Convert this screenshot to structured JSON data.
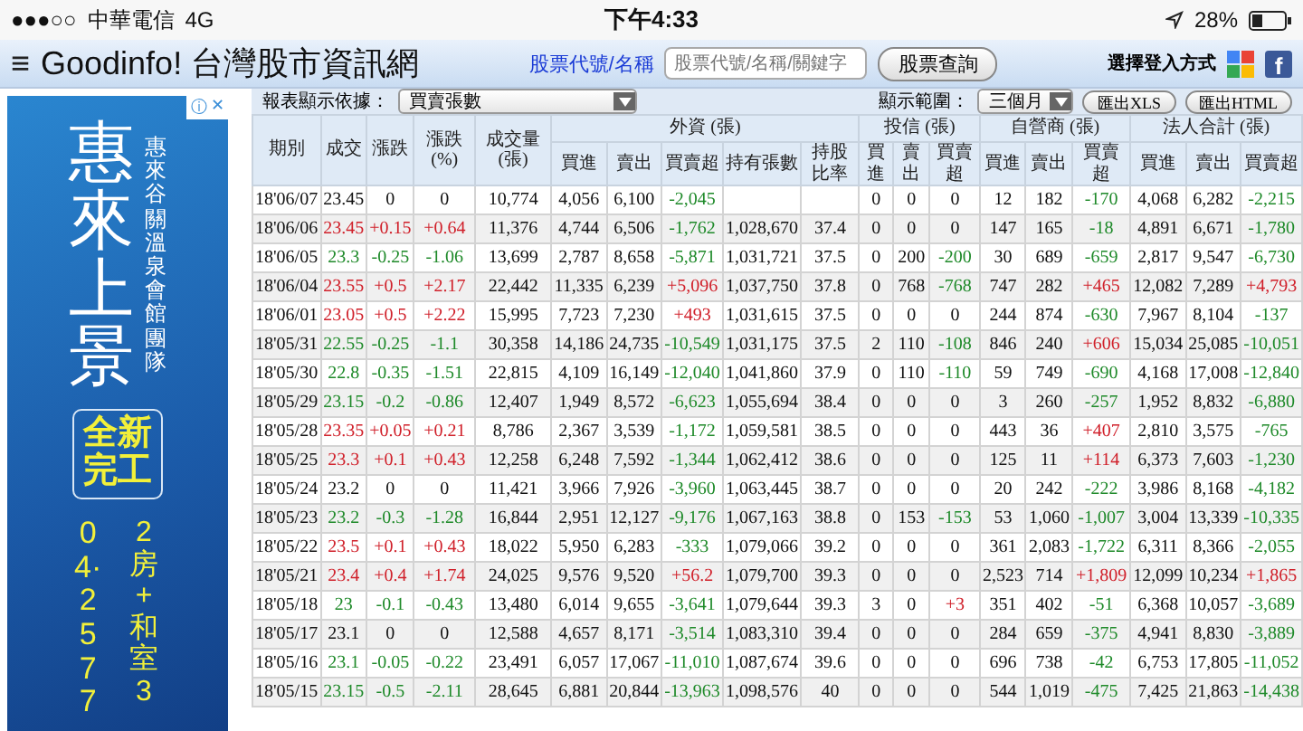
{
  "status_bar": {
    "signal": "●●●○○",
    "carrier": "中華電信",
    "network": "4G",
    "time": "下午4:33",
    "battery": "28%"
  },
  "nav": {
    "menu_glyph": "≡",
    "site_title": "Goodinfo! 台灣股市資訊網",
    "search_link": "股票代號/名稱",
    "search_placeholder": "股票代號/名稱/關鍵字",
    "search_button": "股票查詢",
    "login_label": "選擇登入方式",
    "facebook_glyph": "f"
  },
  "ad": {
    "title": "惠來上景",
    "subtitle": "惠來谷關溫泉會館團隊",
    "badge": "全新完工",
    "phone": "04·2577",
    "rooms": "2房+和室3",
    "info_glyph": "ⓘ",
    "close_glyph": "✕"
  },
  "toolbar": {
    "basis_label": "報表顯示依據：",
    "basis_value": "買賣張數",
    "range_label": "顯示範圍：",
    "range_value": "三個月",
    "buttons": [
      "匯出XLS",
      "匯出HTML"
    ]
  },
  "table": {
    "fixed_columns": [
      {
        "label": "期別",
        "kind": "plain"
      },
      {
        "label": "成交",
        "kind": "price"
      },
      {
        "label": "漲跌",
        "kind": "change"
      },
      {
        "label": "漲跌 (%)",
        "kind": "change"
      },
      {
        "label": "成交量 (張)",
        "kind": "plain"
      }
    ],
    "groups": [
      {
        "label": "外資 (張)",
        "columns": [
          {
            "label": "買進",
            "kind": "plain"
          },
          {
            "label": "賣出",
            "kind": "plain"
          },
          {
            "label": "買賣超",
            "kind": "net"
          },
          {
            "label": "持有張數",
            "kind": "plain"
          },
          {
            "label": "持股比率",
            "kind": "plain"
          }
        ]
      },
      {
        "label": "投信 (張)",
        "columns": [
          {
            "label": "買進",
            "kind": "plain"
          },
          {
            "label": "賣出",
            "kind": "plain"
          },
          {
            "label": "買賣超",
            "kind": "net"
          }
        ]
      },
      {
        "label": "自營商 (張)",
        "columns": [
          {
            "label": "買進",
            "kind": "plain"
          },
          {
            "label": "賣出",
            "kind": "plain"
          },
          {
            "label": "買賣超",
            "kind": "net"
          }
        ]
      },
      {
        "label": "法人合計 (張)",
        "columns": [
          {
            "label": "買進",
            "kind": "plain"
          },
          {
            "label": "賣出",
            "kind": "plain"
          },
          {
            "label": "買賣超",
            "kind": "net"
          }
        ]
      }
    ],
    "rows": [
      [
        "18'06/07",
        "23.45",
        "0",
        "0",
        "10,774",
        "4,056",
        "6,100",
        "-2,045",
        null,
        null,
        "0",
        "0",
        "0",
        "12",
        "182",
        "-170",
        "4,068",
        "6,282",
        "-2,215"
      ],
      [
        "18'06/06",
        "23.45",
        "+0.15",
        "+0.64",
        "11,376",
        "4,744",
        "6,506",
        "-1,762",
        "1,028,670",
        "37.4",
        "0",
        "0",
        "0",
        "147",
        "165",
        "-18",
        "4,891",
        "6,671",
        "-1,780"
      ],
      [
        "18'06/05",
        "23.3",
        "-0.25",
        "-1.06",
        "13,699",
        "2,787",
        "8,658",
        "-5,871",
        "1,031,721",
        "37.5",
        "0",
        "200",
        "-200",
        "30",
        "689",
        "-659",
        "2,817",
        "9,547",
        "-6,730"
      ],
      [
        "18'06/04",
        "23.55",
        "+0.5",
        "+2.17",
        "22,442",
        "11,335",
        "6,239",
        "+5,096",
        "1,037,750",
        "37.8",
        "0",
        "768",
        "-768",
        "747",
        "282",
        "+465",
        "12,082",
        "7,289",
        "+4,793"
      ],
      [
        "18'06/01",
        "23.05",
        "+0.5",
        "+2.22",
        "15,995",
        "7,723",
        "7,230",
        "+493",
        "1,031,615",
        "37.5",
        "0",
        "0",
        "0",
        "244",
        "874",
        "-630",
        "7,967",
        "8,104",
        "-137"
      ],
      [
        "18'05/31",
        "22.55",
        "-0.25",
        "-1.1",
        "30,358",
        "14,186",
        "24,735",
        "-10,549",
        "1,031,175",
        "37.5",
        "2",
        "110",
        "-108",
        "846",
        "240",
        "+606",
        "15,034",
        "25,085",
        "-10,051"
      ],
      [
        "18'05/30",
        "22.8",
        "-0.35",
        "-1.51",
        "22,815",
        "4,109",
        "16,149",
        "-12,040",
        "1,041,860",
        "37.9",
        "0",
        "110",
        "-110",
        "59",
        "749",
        "-690",
        "4,168",
        "17,008",
        "-12,840"
      ],
      [
        "18'05/29",
        "23.15",
        "-0.2",
        "-0.86",
        "12,407",
        "1,949",
        "8,572",
        "-6,623",
        "1,055,694",
        "38.4",
        "0",
        "0",
        "0",
        "3",
        "260",
        "-257",
        "1,952",
        "8,832",
        "-6,880"
      ],
      [
        "18'05/28",
        "23.35",
        "+0.05",
        "+0.21",
        "8,786",
        "2,367",
        "3,539",
        "-1,172",
        "1,059,581",
        "38.5",
        "0",
        "0",
        "0",
        "443",
        "36",
        "+407",
        "2,810",
        "3,575",
        "-765"
      ],
      [
        "18'05/25",
        "23.3",
        "+0.1",
        "+0.43",
        "12,258",
        "6,248",
        "7,592",
        "-1,344",
        "1,062,412",
        "38.6",
        "0",
        "0",
        "0",
        "125",
        "11",
        "+114",
        "6,373",
        "7,603",
        "-1,230"
      ],
      [
        "18'05/24",
        "23.2",
        "0",
        "0",
        "11,421",
        "3,966",
        "7,926",
        "-3,960",
        "1,063,445",
        "38.7",
        "0",
        "0",
        "0",
        "20",
        "242",
        "-222",
        "3,986",
        "8,168",
        "-4,182"
      ],
      [
        "18'05/23",
        "23.2",
        "-0.3",
        "-1.28",
        "16,844",
        "2,951",
        "12,127",
        "-9,176",
        "1,067,163",
        "38.8",
        "0",
        "153",
        "-153",
        "53",
        "1,060",
        "-1,007",
        "3,004",
        "13,339",
        "-10,335"
      ],
      [
        "18'05/22",
        "23.5",
        "+0.1",
        "+0.43",
        "18,022",
        "5,950",
        "6,283",
        "-333",
        "1,079,066",
        "39.2",
        "0",
        "0",
        "0",
        "361",
        "2,083",
        "-1,722",
        "6,311",
        "8,366",
        "-2,055"
      ],
      [
        "18'05/21",
        "23.4",
        "+0.4",
        "+1.74",
        "24,025",
        "9,576",
        "9,520",
        "+56.2",
        "1,079,700",
        "39.3",
        "0",
        "0",
        "0",
        "2,523",
        "714",
        "+1,809",
        "12,099",
        "10,234",
        "+1,865"
      ],
      [
        "18'05/18",
        "23",
        "-0.1",
        "-0.43",
        "13,480",
        "6,014",
        "9,655",
        "-3,641",
        "1,079,644",
        "39.3",
        "3",
        "0",
        "+3",
        "351",
        "402",
        "-51",
        "6,368",
        "10,057",
        "-3,689"
      ],
      [
        "18'05/17",
        "23.1",
        "0",
        "0",
        "12,588",
        "4,657",
        "8,171",
        "-3,514",
        "1,083,310",
        "39.4",
        "0",
        "0",
        "0",
        "284",
        "659",
        "-375",
        "4,941",
        "8,830",
        "-3,889"
      ],
      [
        "18'05/16",
        "23.1",
        "-0.05",
        "-0.22",
        "23,491",
        "6,057",
        "17,067",
        "-11,010",
        "1,087,674",
        "39.6",
        "0",
        "0",
        "0",
        "696",
        "738",
        "-42",
        "6,753",
        "17,805",
        "-11,052"
      ],
      [
        "18'05/15",
        "23.15",
        "-0.5",
        "-2.11",
        "28,645",
        "6,881",
        "20,844",
        "-13,963",
        "1,098,576",
        "40",
        "0",
        "0",
        "0",
        "544",
        "1,019",
        "-475",
        "7,425",
        "21,863",
        "-14,438"
      ]
    ]
  }
}
